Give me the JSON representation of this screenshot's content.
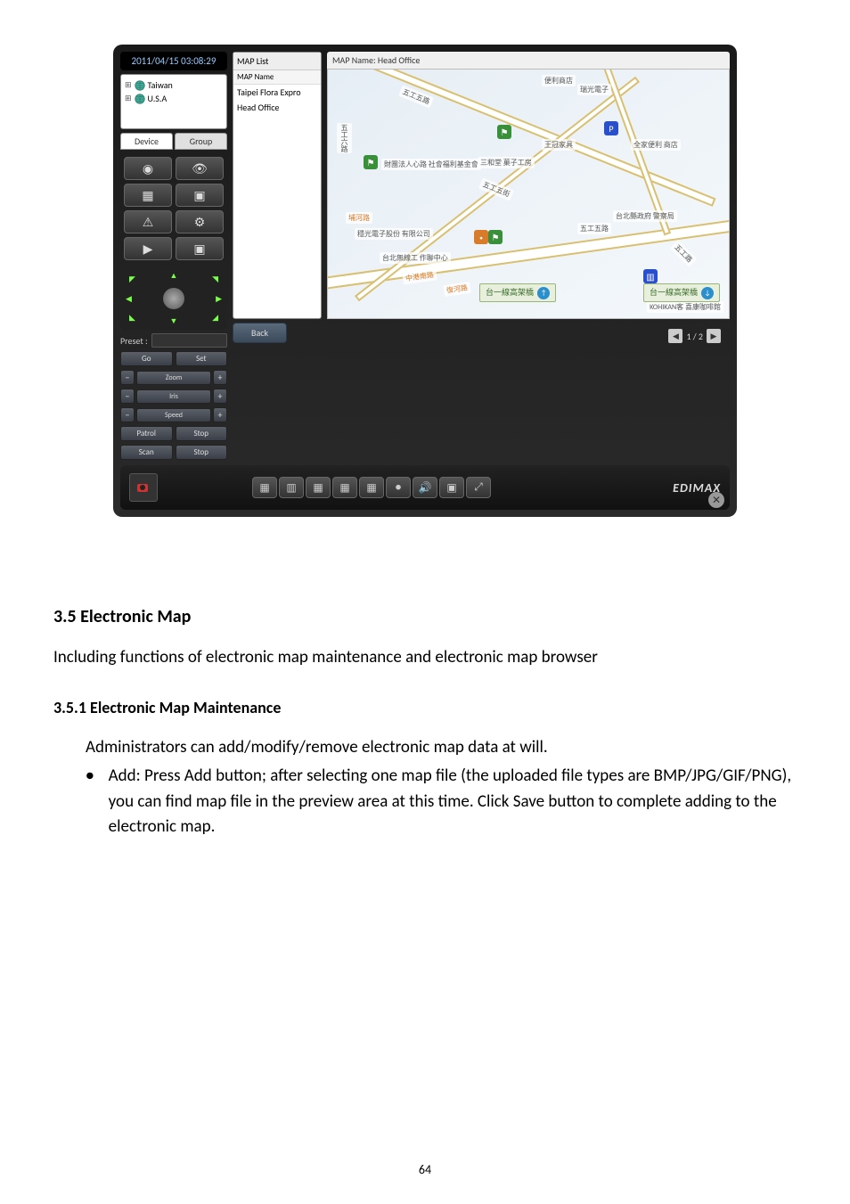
{
  "app": {
    "clock": "2011/04/15 03:08:29",
    "tree": {
      "items": [
        "Taiwan",
        "U.S.A"
      ]
    },
    "tabs": {
      "device": "Device",
      "group": "Group"
    },
    "ptz": {
      "preset_label": "Preset :",
      "go": "Go",
      "set": "Set",
      "zoom": "Zoom",
      "iris": "Iris",
      "speed": "Speed",
      "patrol": "Patrol",
      "scan": "Scan",
      "stop": "Stop"
    },
    "maplist": {
      "title": "MAP List",
      "col": "MAP Name",
      "items": [
        "Taipei Flora Expro",
        "Head Office"
      ]
    },
    "map": {
      "title_prefix": "MAP Name:",
      "title_value": "Head Office",
      "labels": {
        "l1": "便利商店",
        "l2": "瑞光電子",
        "l3": "五工五路",
        "l4": "五工六路",
        "l5": "財團法人心路 社會福利基金會",
        "l6": "五工五街",
        "l7": "埔河路",
        "l8": "穩光電子股份 有限公司",
        "l9": "台北無線工 作聯中心",
        "l10": "中港南路",
        "l11": "復河路",
        "l12": "王冠家具",
        "l13": "三和堂 菓子工房",
        "l14": "全家便利 商店",
        "l15": "台北縣政府 警察局",
        "l16": "五工路",
        "l17": "KOHIKAN客 喜康咖啡館",
        "hwy1": "台一線高架橋",
        "hwy2": "台一線高架橋"
      }
    },
    "back": "Back",
    "pager": {
      "text": "1 / 2"
    },
    "brand": "EDIMAX"
  },
  "doc": {
    "sec_title": "3.5 Electronic Map",
    "sec_body": "Including functions of electronic map maintenance and electronic map browser",
    "sub_title": "3.5.1 Electronic Map Maintenance",
    "sub_intro": "Administrators can add/modify/remove electronic map data at will.",
    "bullet": "Add: Press Add button; after selecting one map file (the uploaded file types are BMP/JPG/GIF/PNG), you can find map file in the preview area at this time. Click Save button to complete adding to the electronic map.",
    "pagenum": "64"
  }
}
